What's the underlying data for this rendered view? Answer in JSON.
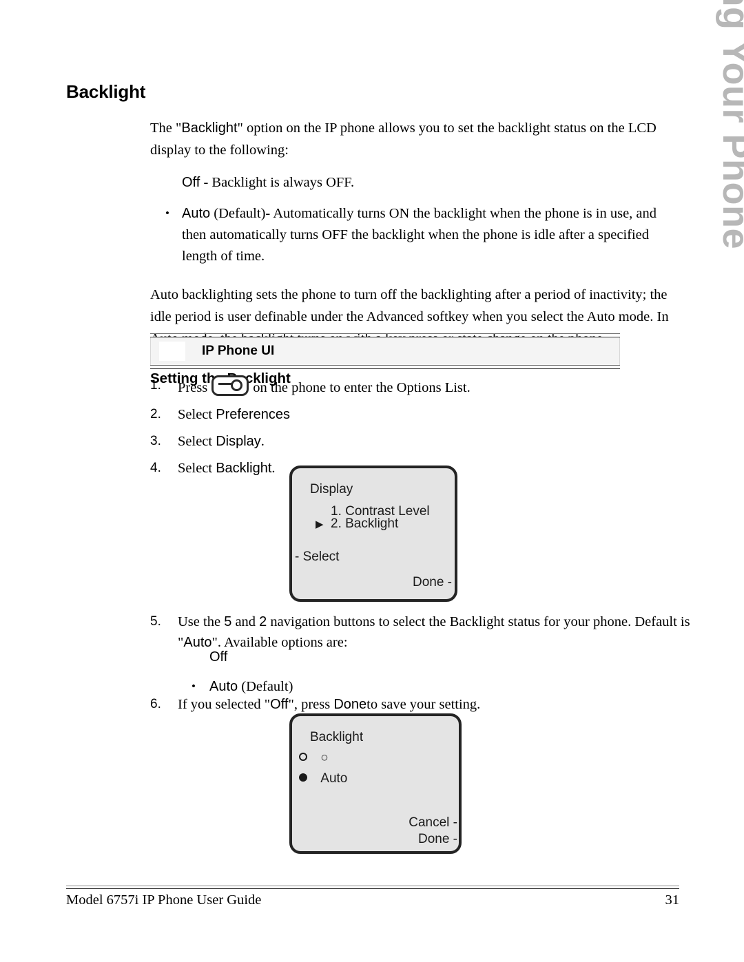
{
  "side_tab": {
    "label": "Customizing Your Phone",
    "color": "#b7b7b7"
  },
  "heading": "Backlight",
  "intro": {
    "part1": "The \"",
    "term": "Backlight",
    "part2": "\" option on the IP phone allows you to set the backlight status on the LCD display to the following:"
  },
  "intro_options": [
    {
      "bullet": "",
      "label": "Off",
      "text": " -  Backlight is always OFF."
    },
    {
      "bullet": "•",
      "label": "Auto",
      "text": " (Default)- Automatically turns ON the backlight when the phone is in use, and then automatically turns OFF the backlight when the phone is idle after a specified length of time."
    }
  ],
  "para2": "Auto backlighting sets the phone to turn off the backlighting after a period of inactivity; the idle period is user definable under the Advanced softkey when you select the Auto mode. In Auto mode, the backlight turns on with a key press or state change on the phone.",
  "subheading": "Setting the Backlight",
  "band": {
    "title": "IP Phone UI"
  },
  "steps": [
    {
      "num": "1.",
      "pre": "Press",
      "icon": "options-key-icon",
      "post": "on the phone to enter the Options List."
    },
    {
      "num": "2.",
      "pre": "Select",
      "ui": "Preferences",
      "post": ""
    },
    {
      "num": "3.",
      "pre": "Select",
      "ui": "Display",
      "post": "."
    },
    {
      "num": "4.",
      "pre": "Select",
      "ui": "Backlight",
      "post": "."
    },
    {
      "num": "5.",
      "pre": "Use the",
      "k1": "5",
      "mid": "and",
      "k2": "2",
      "post": "navigation buttons to select the Backlight status for your phone. Default is \"",
      "ui": "Auto",
      "tail": "\". Available options are:"
    },
    {
      "num": "6.",
      "pre": "If you selected \"",
      "ui": "Off",
      "mid": "\", press",
      "ui2": "Done",
      "post": "to save your setting."
    }
  ],
  "step5_options": [
    {
      "bullet": "",
      "label": "Off"
    },
    {
      "bullet": "•",
      "label": "Auto",
      "suffix": " (Default)"
    }
  ],
  "lcd_display": {
    "title": "Display",
    "items": [
      {
        "marker": "",
        "text": "1. Contrast Level"
      },
      {
        "marker": "▶",
        "text": "2. Backlight"
      }
    ],
    "softkey_left": "- Select",
    "softkey_right": "Done -"
  },
  "lcd_backlight": {
    "title": "Backlight",
    "options": [
      {
        "selected": false,
        "label": "○"
      },
      {
        "selected": true,
        "label": "Auto"
      }
    ],
    "softkey_cancel": "Cancel -",
    "softkey_done": "Done -"
  },
  "footer": {
    "left": "Model 6757i IP Phone User Guide",
    "page": "31"
  }
}
